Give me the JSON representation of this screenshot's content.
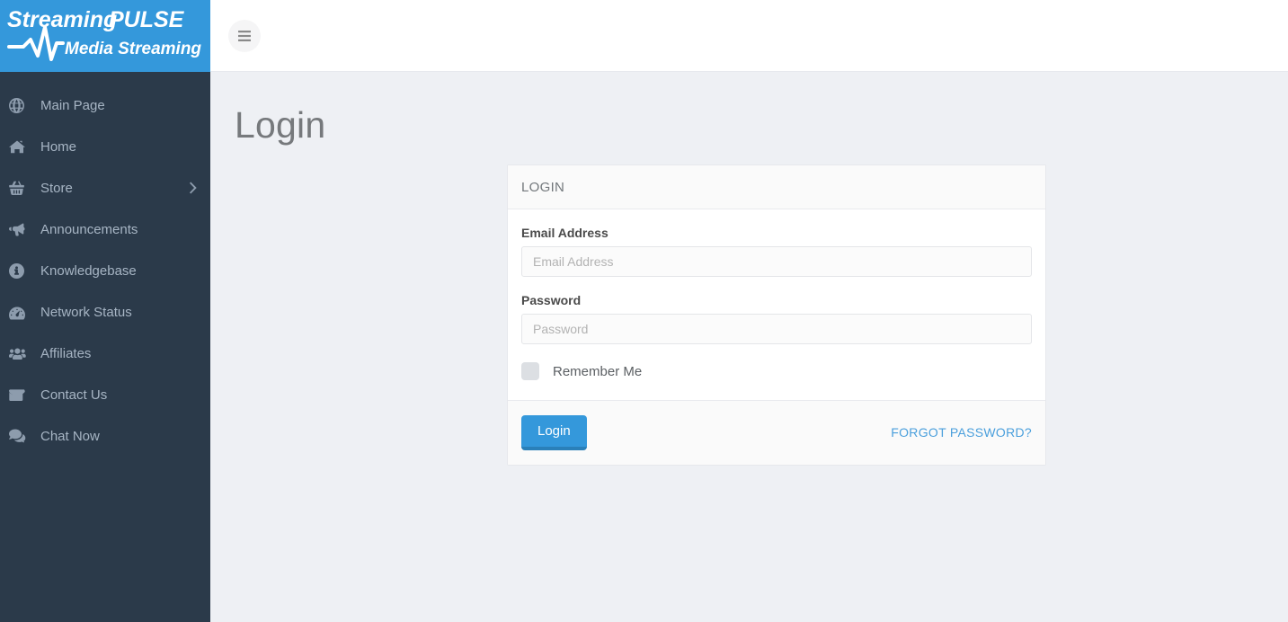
{
  "brand": {
    "line1": "Streaming PULSE",
    "line2": "Media Streaming",
    "bg_color": "#3498db"
  },
  "sidebar": {
    "bg_color": "#2b3a4a",
    "items": [
      {
        "label": "Main Page",
        "icon": "globe-icon",
        "has_caret": false
      },
      {
        "label": "Home",
        "icon": "home-icon",
        "has_caret": false
      },
      {
        "label": "Store",
        "icon": "basket-icon",
        "has_caret": true
      },
      {
        "label": "Announcements",
        "icon": "megaphone-icon",
        "has_caret": false
      },
      {
        "label": "Knowledgebase",
        "icon": "info-circle-icon",
        "has_caret": false
      },
      {
        "label": "Network Status",
        "icon": "tachometer-icon",
        "has_caret": false
      },
      {
        "label": "Affiliates",
        "icon": "users-icon",
        "has_caret": false
      },
      {
        "label": "Contact Us",
        "icon": "envelope-icon",
        "has_caret": false
      },
      {
        "label": "Chat Now",
        "icon": "comments-icon",
        "has_caret": false
      }
    ]
  },
  "topbar": {
    "menu_toggle_icon": "hamburger-icon"
  },
  "page": {
    "title": "Login"
  },
  "login_card": {
    "header": "LOGIN",
    "email": {
      "label": "Email Address",
      "placeholder": "Email Address",
      "value": ""
    },
    "password": {
      "label": "Password",
      "placeholder": "Password",
      "value": ""
    },
    "remember_me": {
      "label": "Remember Me",
      "checked": false
    },
    "submit_label": "Login",
    "forgot_password_label": "FORGOT PASSWORD?",
    "accent_color": "#3498db"
  }
}
